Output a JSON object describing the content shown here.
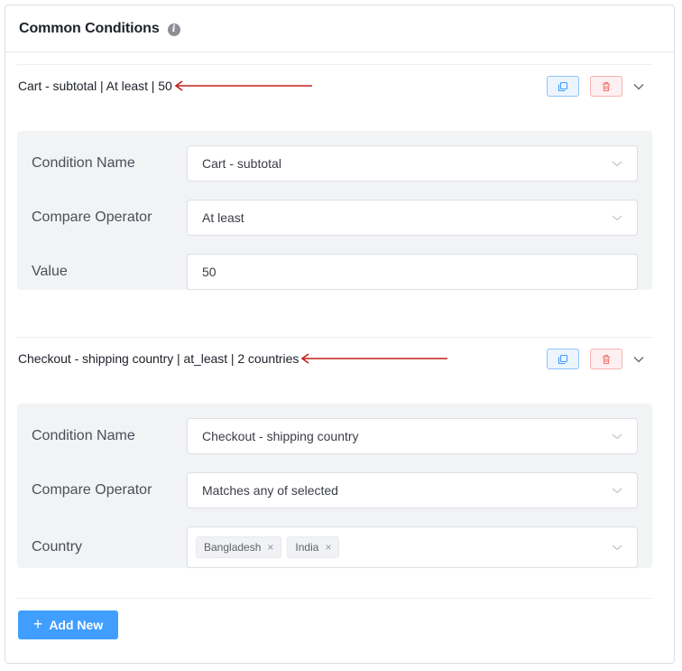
{
  "panel": {
    "title": "Common Conditions",
    "info_icon": "i"
  },
  "conditions": [
    {
      "summary": "Cart - subtotal | At least | 50",
      "rows": [
        {
          "label": "Condition Name",
          "value": "Cart - subtotal"
        },
        {
          "label": "Compare Operator",
          "value": "At least"
        },
        {
          "label": "Value",
          "value": "50"
        }
      ]
    },
    {
      "summary": "Checkout - shipping country | at_least | 2 countries",
      "rows": [
        {
          "label": "Condition Name",
          "value": "Checkout - shipping country"
        },
        {
          "label": "Compare Operator",
          "value": "Matches any of selected"
        },
        {
          "label": "Country",
          "tags": [
            "Bangladesh",
            "India"
          ]
        }
      ]
    }
  ],
  "add_button": {
    "label": "Add New",
    "icon": "plus-icon"
  },
  "colors": {
    "primary": "#409eff",
    "danger": "#f56c6c",
    "annotation_arrow": "#c0201b"
  },
  "tag_close_glyph": "×"
}
